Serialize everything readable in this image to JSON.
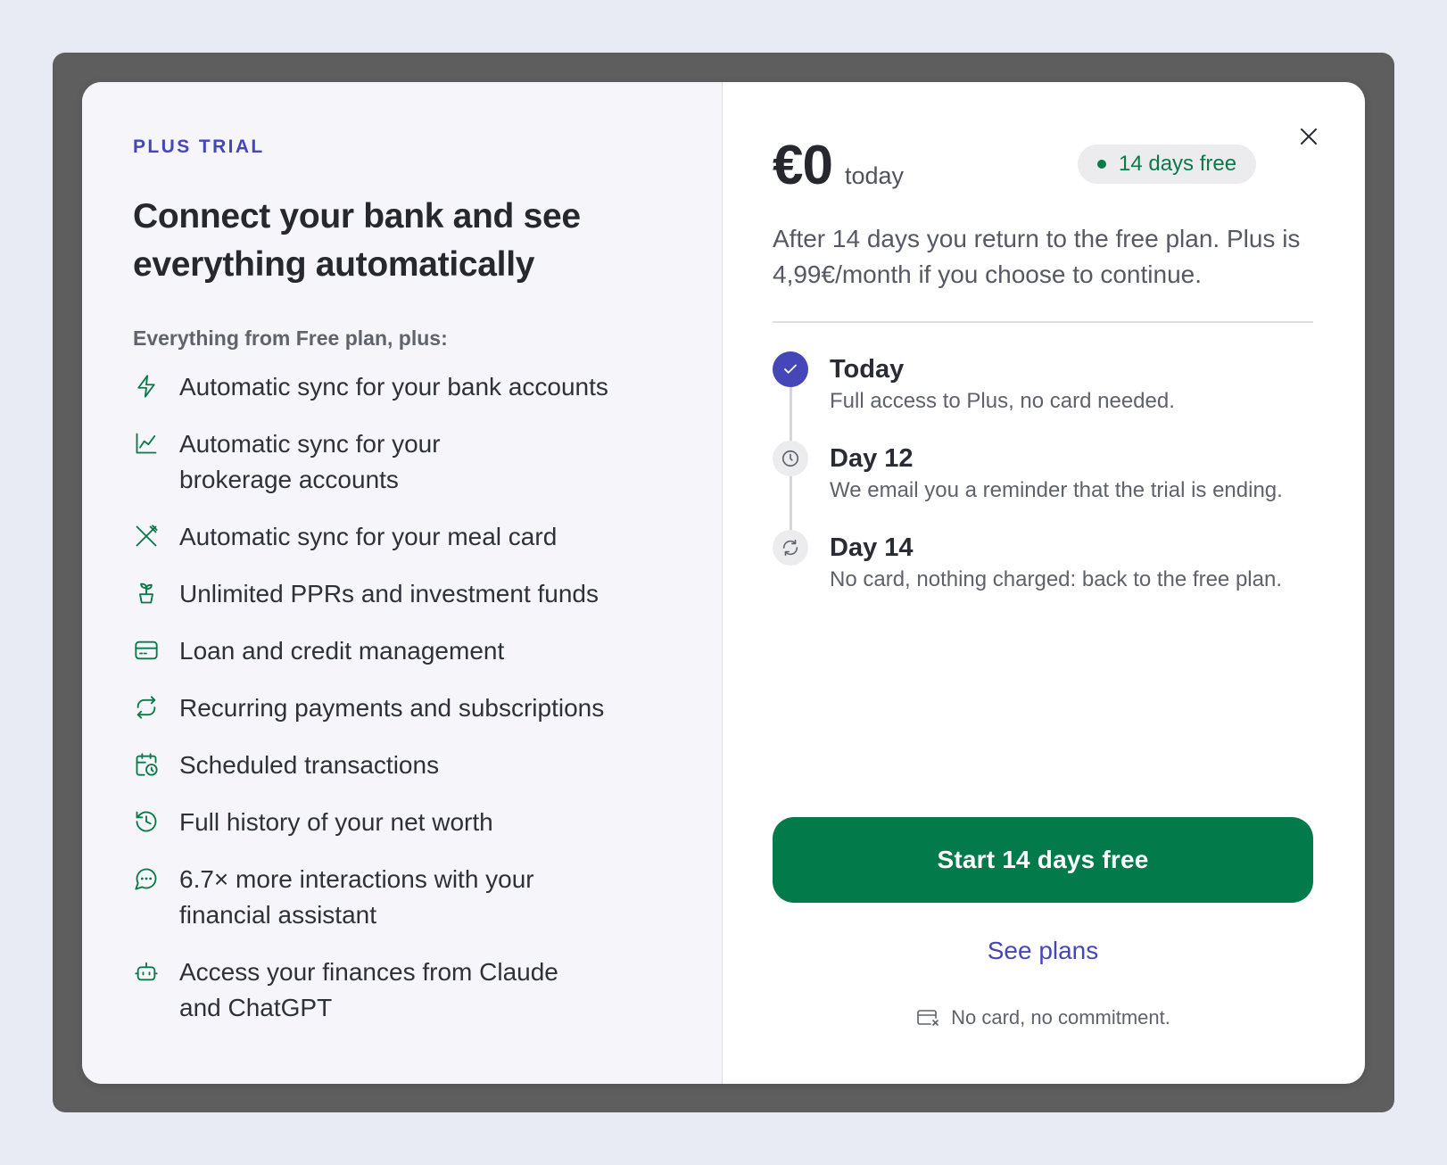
{
  "modal": {
    "eyebrow": "PLUS TRIAL",
    "headline": "Connect your bank and see everything automatically",
    "subhead": "Everything from Free plan, plus:",
    "features": [
      {
        "icon": "lightning-icon",
        "label": "Automatic sync for your bank accounts"
      },
      {
        "icon": "line-chart-icon",
        "label": "Automatic sync for your brokerage accounts"
      },
      {
        "icon": "utensils-icon",
        "label": "Automatic sync for your meal card"
      },
      {
        "icon": "plant-pot-icon",
        "label": "Unlimited PPRs and investment funds"
      },
      {
        "icon": "credit-card-icon",
        "label": "Loan and credit management"
      },
      {
        "icon": "repeat-icon",
        "label": "Recurring payments and subscriptions"
      },
      {
        "icon": "calendar-clock-icon",
        "label": "Scheduled transactions"
      },
      {
        "icon": "history-icon",
        "label": "Full history of your net worth"
      },
      {
        "icon": "chat-bubble-icon",
        "label": "6.7× more interactions with your financial assistant"
      },
      {
        "icon": "bot-icon",
        "label": "Access your finances from Claude and ChatGPT"
      }
    ],
    "price": "€0",
    "price_suffix": "today",
    "badge": "14 days free",
    "description": "After 14 days you return to the free plan. Plus is 4,99€/month if you choose to continue.",
    "timeline": [
      {
        "title": "Today",
        "desc": "Full access to Plus, no card needed.",
        "icon": "check-icon",
        "state": "done"
      },
      {
        "title": "Day 12",
        "desc": "We email you a reminder that the trial is ending.",
        "icon": "clock-icon",
        "state": "pending"
      },
      {
        "title": "Day 14",
        "desc": "No card, nothing charged: back to the free plan.",
        "icon": "refresh-icon",
        "state": "pending"
      }
    ],
    "cta_label": "Start 14 days free",
    "plans_link": "See plans",
    "note": "No card, no commitment."
  },
  "colors": {
    "accent": "#4547b8",
    "brand_green": "#027a4a",
    "backdrop": "#5e5e5e",
    "page_bg": "#e8ebf3"
  }
}
